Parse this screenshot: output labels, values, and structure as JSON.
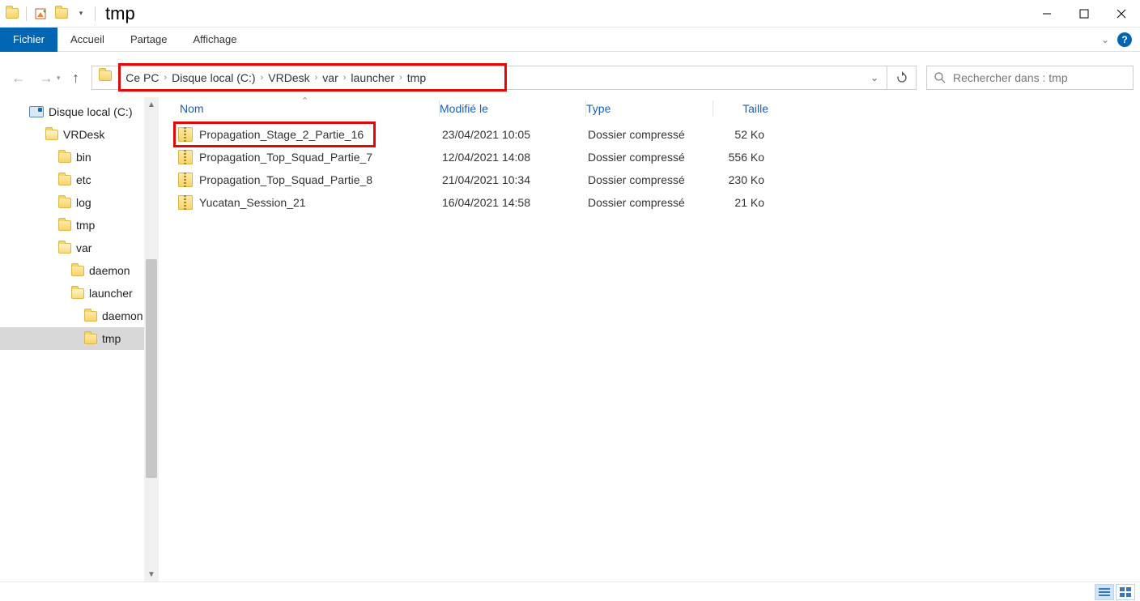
{
  "window": {
    "title": "tmp"
  },
  "ribbon": {
    "file": "Fichier",
    "tabs": [
      "Accueil",
      "Partage",
      "Affichage"
    ]
  },
  "breadcrumbs": [
    "Ce PC",
    "Disque local (C:)",
    "VRDesk",
    "var",
    "launcher",
    "tmp"
  ],
  "search": {
    "placeholder": "Rechercher dans : tmp"
  },
  "tree": [
    {
      "label": "Disque local (C:)",
      "indent": 36,
      "icon": "drive"
    },
    {
      "label": "VRDesk",
      "indent": 56,
      "icon": "folder-open"
    },
    {
      "label": "bin",
      "indent": 72,
      "icon": "folder"
    },
    {
      "label": "etc",
      "indent": 72,
      "icon": "folder"
    },
    {
      "label": "log",
      "indent": 72,
      "icon": "folder"
    },
    {
      "label": "tmp",
      "indent": 72,
      "icon": "folder"
    },
    {
      "label": "var",
      "indent": 72,
      "icon": "folder-open"
    },
    {
      "label": "daemon",
      "indent": 88,
      "icon": "folder"
    },
    {
      "label": "launcher",
      "indent": 88,
      "icon": "folder-open"
    },
    {
      "label": "daemon",
      "indent": 104,
      "icon": "folder"
    },
    {
      "label": "tmp",
      "indent": 104,
      "icon": "folder",
      "selected": true
    }
  ],
  "columns": {
    "name": "Nom",
    "modified": "Modifié le",
    "type": "Type",
    "size": "Taille"
  },
  "files": [
    {
      "name": "Propagation_Stage_2_Partie_16",
      "modified": "23/04/2021 10:05",
      "type": "Dossier compressé",
      "size": "52 Ko",
      "highlight": true
    },
    {
      "name": "Propagation_Top_Squad_Partie_7",
      "modified": "12/04/2021 14:08",
      "type": "Dossier compressé",
      "size": "556 Ko",
      "highlight": false
    },
    {
      "name": "Propagation_Top_Squad_Partie_8",
      "modified": "21/04/2021 10:34",
      "type": "Dossier compressé",
      "size": "230 Ko",
      "highlight": false
    },
    {
      "name": "Yucatan_Session_21",
      "modified": "16/04/2021 14:58",
      "type": "Dossier compressé",
      "size": "21 Ko",
      "highlight": false
    }
  ]
}
